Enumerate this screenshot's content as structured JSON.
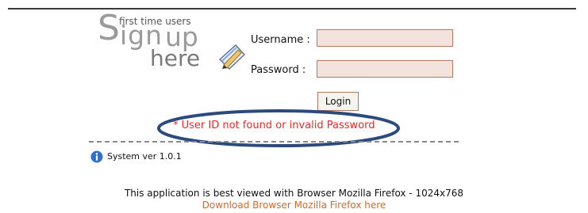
{
  "logo": {
    "first_time": "first time users",
    "sign": "Sign",
    "up": "up",
    "here": "here"
  },
  "form": {
    "username_label": "Username :",
    "username_value": "",
    "password_label": "Password :",
    "password_value": "",
    "login_label": "Login"
  },
  "error": {
    "marker": "*",
    "message": "User ID not found or invalid Password"
  },
  "system": {
    "version": "System ver 1.0.1"
  },
  "footer": {
    "browser_note": "This application is best viewed with Browser Mozilla Firefox - 1024x768",
    "download_link": "Download Browser Mozilla Firefox here"
  },
  "colors": {
    "input_bg": "#f3e3dc",
    "input_border": "#b37a63",
    "error_text": "#ee2a2a",
    "link_text": "#d36b2b",
    "annotation_ellipse": "#2b4a7e"
  },
  "icons": [
    "pen-pencil-icon",
    "info-icon"
  ]
}
